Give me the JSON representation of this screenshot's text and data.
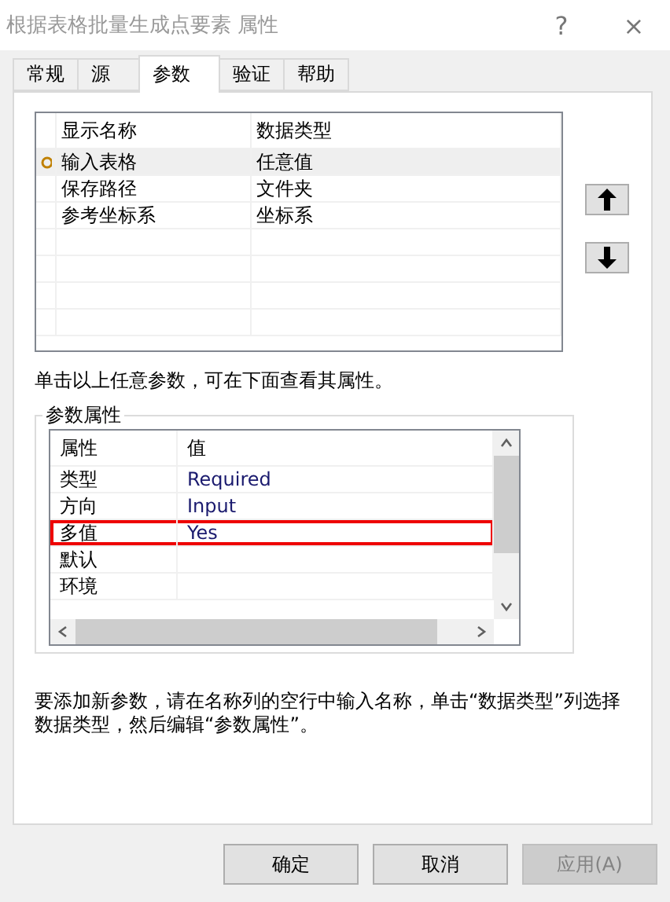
{
  "window": {
    "title": "根据表格批量生成点要素 属性",
    "help": "?",
    "close": "×"
  },
  "tabs": [
    {
      "label": "常规",
      "selected": false
    },
    {
      "label": "源",
      "selected": false
    },
    {
      "label": "参数",
      "selected": true
    },
    {
      "label": "验证",
      "selected": false
    },
    {
      "label": "帮助",
      "selected": false
    }
  ],
  "param_table": {
    "columns": [
      "显示名称",
      "数据类型"
    ],
    "rows": [
      {
        "cells": [
          "输入表格",
          "任意值"
        ],
        "selected": true
      },
      {
        "cells": [
          "保存路径",
          "文件夹"
        ],
        "selected": false
      },
      {
        "cells": [
          "参考坐标系",
          "坐标系"
        ],
        "selected": false
      }
    ]
  },
  "move_buttons": [
    {
      "kind": "up"
    },
    {
      "kind": "down"
    }
  ],
  "hint_top": "单击以上任意参数，可在下面查看其属性。",
  "properties": {
    "title": "参数属性",
    "columns": [
      "属性",
      "值"
    ],
    "rows": [
      {
        "cells": [
          "类型",
          "Required"
        ],
        "highlighted": false
      },
      {
        "cells": [
          "方向",
          "Input"
        ],
        "highlighted": false
      },
      {
        "cells": [
          "多值",
          "Yes"
        ],
        "highlighted": true
      },
      {
        "cells": [
          "默认",
          ""
        ],
        "highlighted": false
      },
      {
        "cells": [
          "环境",
          ""
        ],
        "highlighted": false
      }
    ]
  },
  "hint_bottom": "要添加新参数，请在名称列的空行中输入名称，单击“数据类型”列选择数据类型，然后编辑“参数属性”。",
  "buttons": [
    {
      "label": "确定",
      "disabled": false
    },
    {
      "label": "取消",
      "disabled": false
    },
    {
      "label": "应用(A)",
      "disabled": true
    }
  ]
}
